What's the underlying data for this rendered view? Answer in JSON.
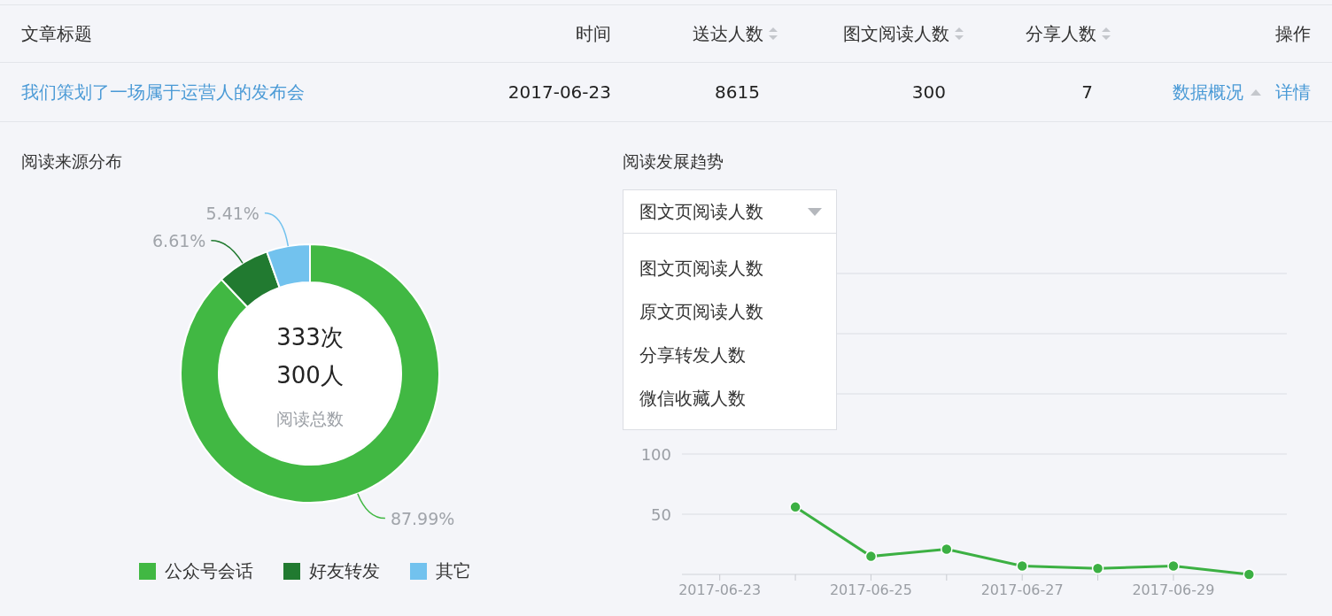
{
  "table": {
    "columns": [
      {
        "label": "文章标题",
        "sortable": false
      },
      {
        "label": "时间",
        "sortable": false
      },
      {
        "label": "送达人数",
        "sortable": true
      },
      {
        "label": "图文阅读人数",
        "sortable": true
      },
      {
        "label": "分享人数",
        "sortable": true
      },
      {
        "label": "操作",
        "sortable": false
      }
    ],
    "rows": [
      {
        "cells": [
          "我们策划了一场属于运营人的发布会",
          "2017-06-23",
          "8615",
          "300",
          "7"
        ],
        "actions": [
          {
            "label": "数据概况",
            "kind": "toggle",
            "expanded": true
          },
          {
            "label": "详情",
            "kind": "link"
          }
        ]
      }
    ]
  },
  "source_panel": {
    "title": "阅读来源分布",
    "center": {
      "count": "333次",
      "people": "300人",
      "caption": "阅读总数"
    },
    "chart_data": {
      "type": "donut",
      "series": [
        {
          "values": [
            87.99,
            6.61,
            5.41
          ]
        }
      ],
      "value_labels": [
        "87.99%",
        "6.61%",
        "5.41%"
      ]
    },
    "legend": [
      {
        "label": "公众号会话",
        "color": "#41b843"
      },
      {
        "label": "好友转发",
        "color": "#217a30"
      },
      {
        "label": "其它",
        "color": "#72c2ee"
      }
    ]
  },
  "trend_panel": {
    "title": "阅读发展趋势",
    "select": {
      "value": "图文页阅读人数",
      "expanded": true,
      "options": [
        "图文页阅读人数",
        "原文页阅读人数",
        "分享转发人数",
        "微信收藏人数"
      ]
    },
    "chart_data": {
      "type": "line",
      "categories": [
        "2017-06-23",
        null,
        "2017-06-25",
        null,
        "2017-06-27",
        null,
        "2017-06-29",
        null
      ],
      "series": [
        {
          "color": "#3cb043",
          "marker": "o",
          "values": [
            null,
            56,
            15,
            21,
            7,
            5,
            7,
            0
          ]
        }
      ],
      "ylim": [
        0,
        250
      ],
      "yticks": [
        50,
        100
      ]
    }
  }
}
